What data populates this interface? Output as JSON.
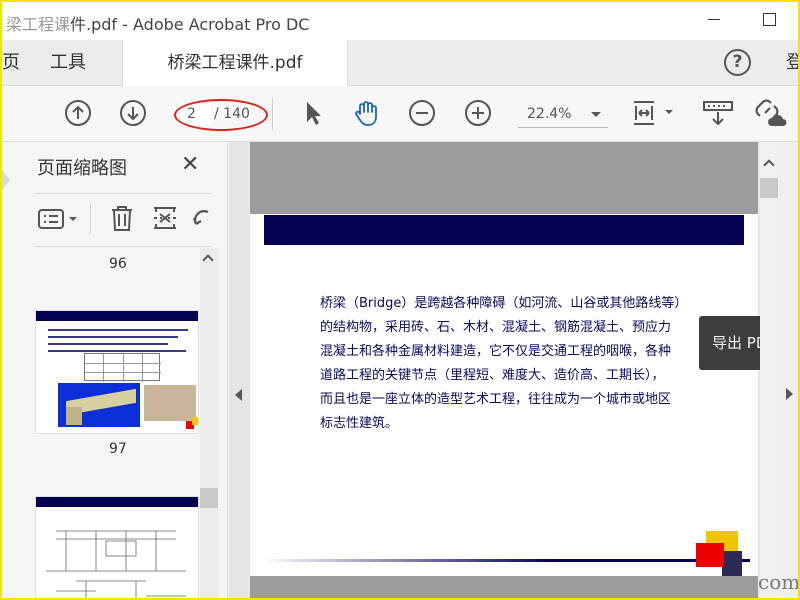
{
  "window": {
    "title_prefix": "梁工程课",
    "title": "件.pdf - Adobe Acrobat Pro DC"
  },
  "tabs": {
    "home": "页",
    "tools": "工具",
    "document": "桥梁工程课件.pdf",
    "login": "登"
  },
  "toolbar": {
    "current_page": "2",
    "total_pages": "/ 140",
    "zoom": "22.4%"
  },
  "left_panel": {
    "title": "页面缩略图",
    "page_labels": [
      "96",
      "97"
    ]
  },
  "document": {
    "paragraph_lines": [
      "桥梁（Bridge）是跨越各种障碍（如河流、山谷或其他路线等）",
      "的结构物，采用砖、石、木材、混凝土、钢筋混凝土、预应力",
      "混凝土和各种金属材料建造，它不仅是交通工程的咽喉，各种",
      "道路工程的关键节点（里程短、难度大、造价高、工期长），",
      "而且也是一座立体的造型艺术工程，往往成为一个城市或地区",
      "标志性建筑。"
    ]
  },
  "export_button": "导出 PDF",
  "watermark": "com",
  "colors": {
    "page_navy": "#030251",
    "accent_red": "#ee0000",
    "accent_yellow": "#f2c500",
    "annotation_red": "#d9251c",
    "frame_yellow": "#f2e600"
  },
  "icons": [
    "previous-page-icon",
    "next-page-icon",
    "select-arrow-icon",
    "hand-tool-icon",
    "zoom-out-icon",
    "zoom-in-icon",
    "fit-page-icon",
    "scroll-mode-icon",
    "link-cloud-icon",
    "help-icon",
    "close-icon",
    "options-menu-icon",
    "delete-icon",
    "extract-icon",
    "rotate-icon"
  ]
}
